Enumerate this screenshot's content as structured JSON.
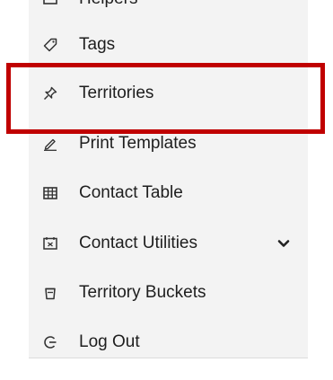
{
  "menu": {
    "items": [
      {
        "label": "Helpers",
        "icon": "helpers-icon"
      },
      {
        "label": "Tags",
        "icon": "tag-icon"
      },
      {
        "label": "Territories",
        "icon": "pin-icon"
      },
      {
        "label": "Print Templates",
        "icon": "pencil-icon"
      },
      {
        "label": "Contact Table",
        "icon": "table-icon"
      },
      {
        "label": "Contact Utilities",
        "icon": "contact-card-icon",
        "expandable": true
      },
      {
        "label": "Territory Buckets",
        "icon": "bucket-icon"
      },
      {
        "label": "Log Out",
        "icon": "logout-icon"
      }
    ]
  },
  "highlight": {
    "target": "Territories",
    "color": "#c00000"
  },
  "colors": {
    "panel_bg": "#f3f3f3",
    "text": "#1e1e1e"
  }
}
